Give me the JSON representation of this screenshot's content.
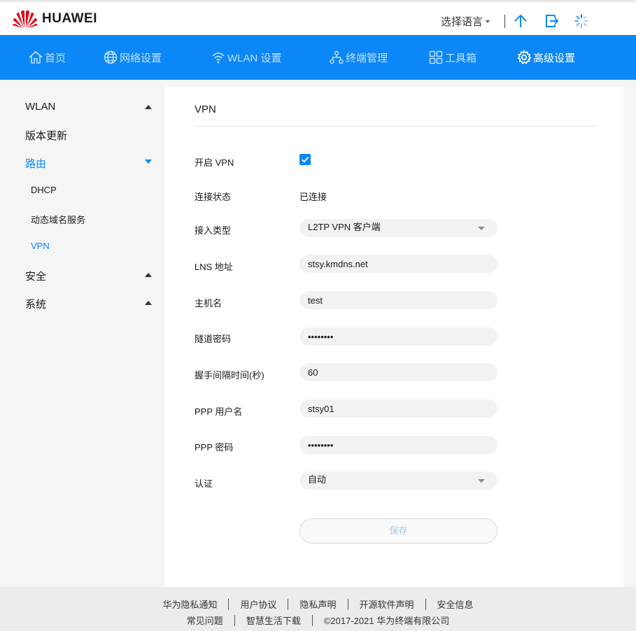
{
  "header": {
    "brand": "HUAWEI",
    "language_label": "选择语言"
  },
  "nav": {
    "items": [
      {
        "label": "首页",
        "icon": "home-icon"
      },
      {
        "label": "网络设置",
        "icon": "globe-icon"
      },
      {
        "label": "WLAN 设置",
        "icon": "wifi-icon"
      },
      {
        "label": "终端管理",
        "icon": "devices-icon"
      },
      {
        "label": "工具箱",
        "icon": "toolbox-icon"
      },
      {
        "label": "高级设置",
        "icon": "gear-icon",
        "active": true
      }
    ]
  },
  "sidebar": {
    "items": [
      {
        "label": "WLAN",
        "expanded": false
      },
      {
        "label": "版本更新"
      },
      {
        "label": "路由",
        "expanded": true,
        "active": true
      },
      {
        "label": "DHCP"
      },
      {
        "label": "动态域名服务"
      },
      {
        "label": "VPN",
        "active": true
      },
      {
        "label": "安全",
        "expanded": false
      },
      {
        "label": "系统",
        "expanded": false
      }
    ]
  },
  "vpn": {
    "title": "VPN",
    "fields": {
      "enable": {
        "label": "开启 VPN",
        "checked": true
      },
      "status": {
        "label": "连接状态",
        "value": "已连接"
      },
      "access_type": {
        "label": "接入类型",
        "value": "L2TP VPN 客户端"
      },
      "lns": {
        "label": "LNS 地址",
        "value": "stsy.kmdns.net"
      },
      "hostname": {
        "label": "主机名",
        "value": "test"
      },
      "tunnel_pwd": {
        "label": "隧道密码",
        "value": "••••••••"
      },
      "hello_interval": {
        "label": "握手间隔时间(秒)",
        "value": "60"
      },
      "ppp_user": {
        "label": "PPP 用户名",
        "value": "stsy01"
      },
      "ppp_pwd": {
        "label": "PPP 密码",
        "value": "••••••••"
      },
      "auth": {
        "label": "认证",
        "value": "自动"
      }
    },
    "save_label": "保存"
  },
  "footer": {
    "row1": [
      "华为隐私通知",
      "用户协议",
      "隐私声明",
      "开源软件声明",
      "安全信息"
    ],
    "row2": [
      "常见问题",
      "智慧生活下载",
      "©2017-2021 华为终端有限公司"
    ]
  },
  "colors": {
    "accent": "#0b87f7",
    "nav_inactive_text": "#bfe0ff",
    "page_bg": "#f5f5f5"
  }
}
